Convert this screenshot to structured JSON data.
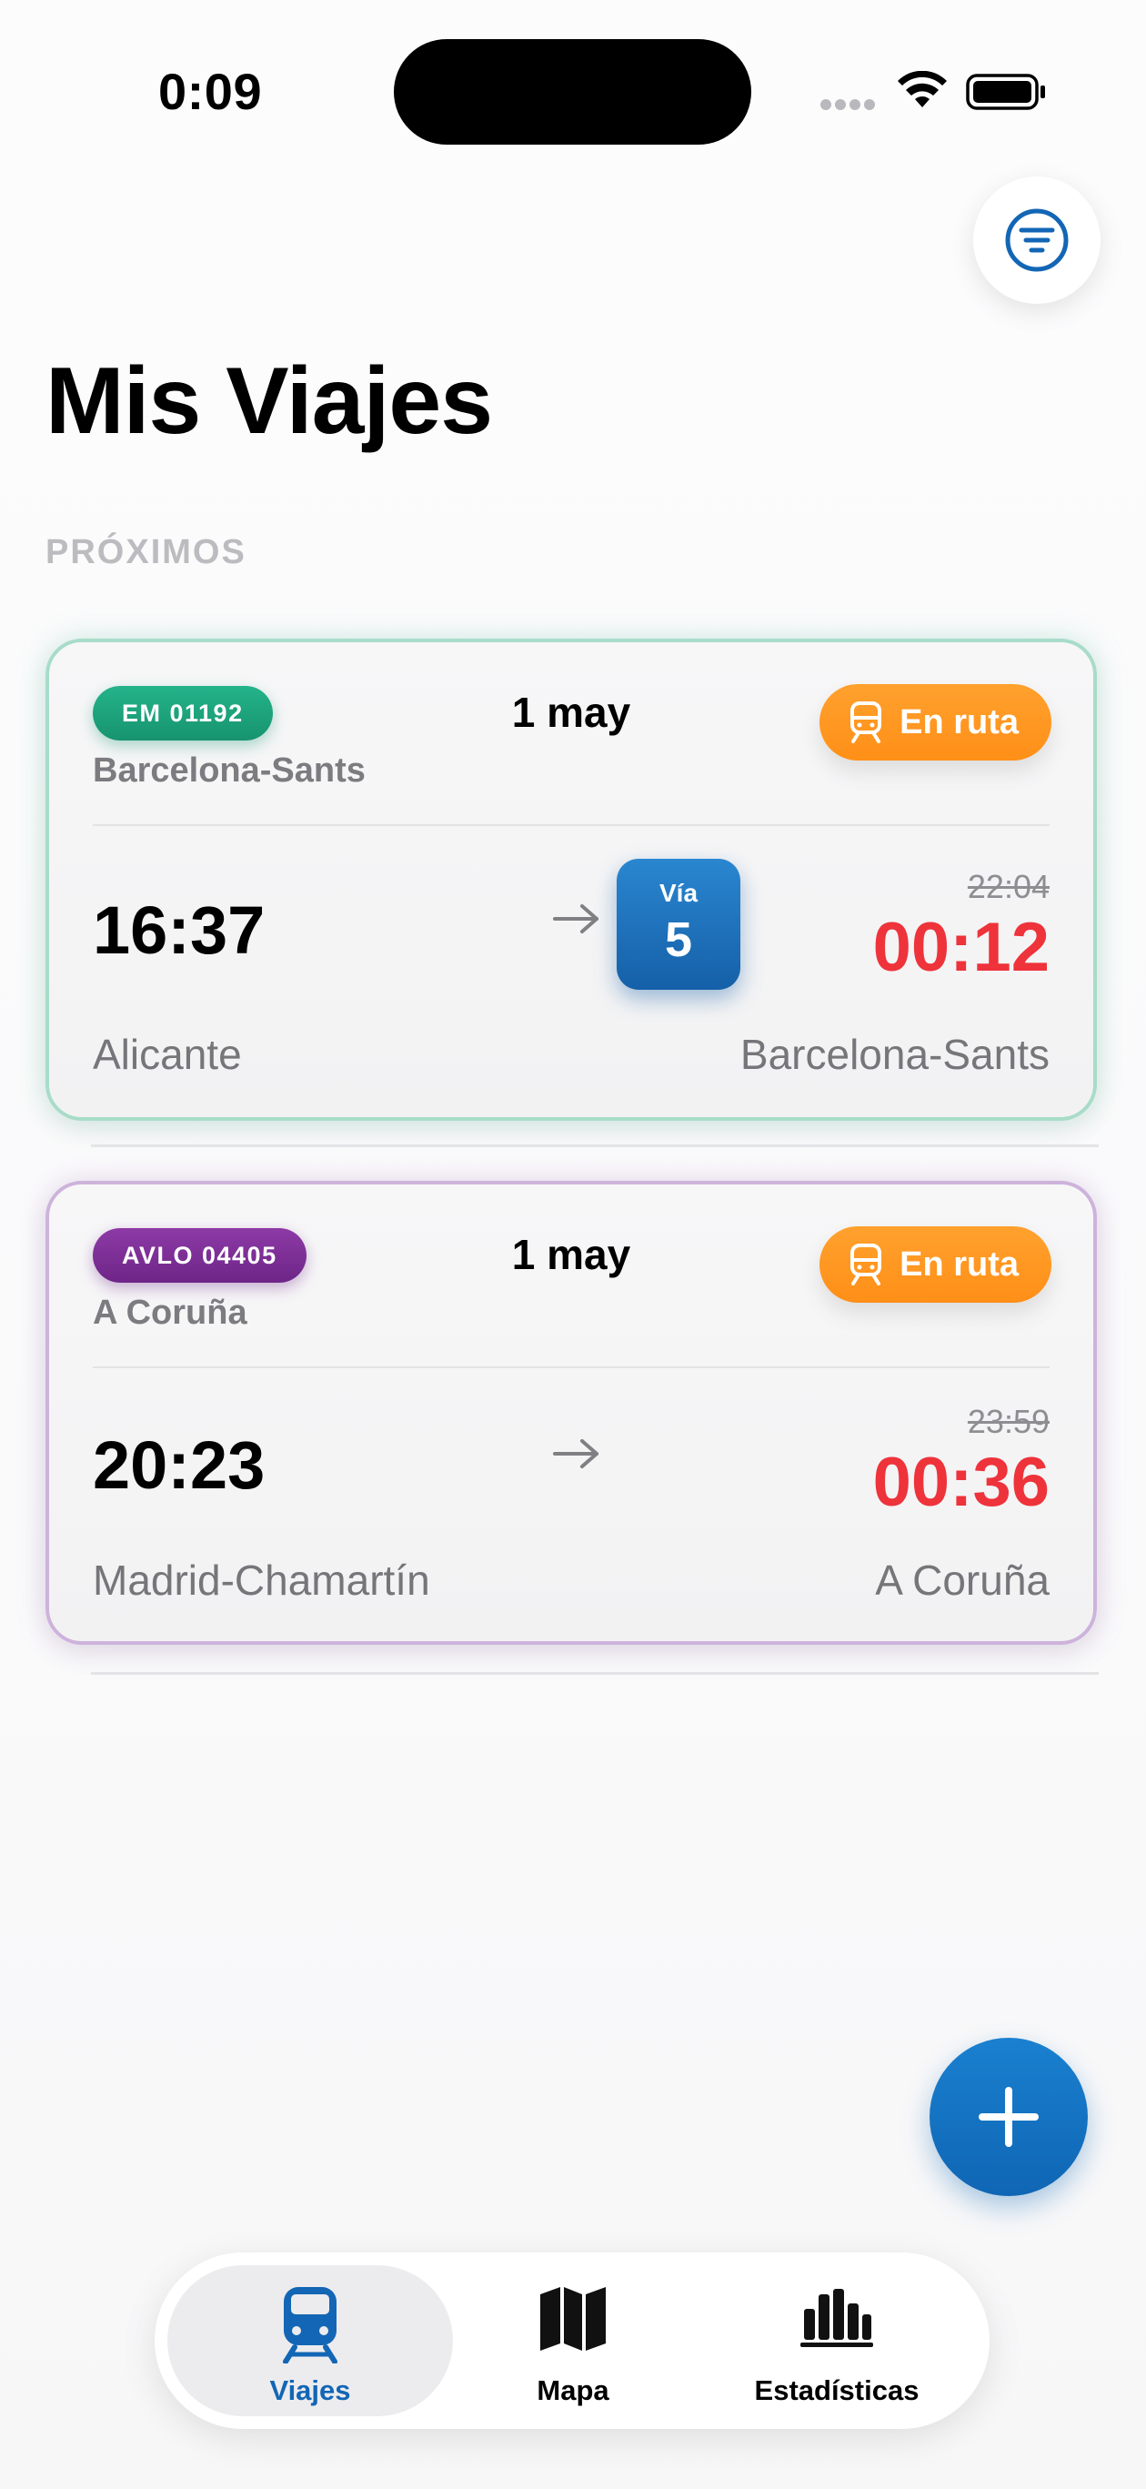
{
  "status_bar": {
    "time": "0:09"
  },
  "header": {
    "title": "Mis Viajes",
    "filter_icon": "filter-icon"
  },
  "section": {
    "label": "PRÓXIMOS"
  },
  "trips": [
    {
      "badge": "EM 01192",
      "badge_color": "#17946f",
      "subtitle": "Barcelona-Sants",
      "date": "1 may",
      "status": "En ruta",
      "status_icon": "train-icon",
      "departure_time": "16:37",
      "platform_label": "Vía",
      "platform_number": "5",
      "scheduled_arrival": "22:04",
      "actual_arrival": "00:12",
      "origin": "Alicante",
      "destination": "Barcelona-Sants"
    },
    {
      "badge": "AVLO 04405",
      "badge_color": "#6e2587",
      "subtitle": "A Coruña",
      "date": "1 may",
      "status": "En ruta",
      "status_icon": "train-icon",
      "departure_time": "20:23",
      "scheduled_arrival": "23:59",
      "actual_arrival": "00:36",
      "origin": "Madrid-Chamartín",
      "destination": "A Coruña"
    }
  ],
  "fab": {
    "icon": "plus-icon"
  },
  "tab_bar": {
    "tabs": [
      {
        "label": "Viajes",
        "icon": "train-icon",
        "active": true
      },
      {
        "label": "Mapa",
        "icon": "map-icon",
        "active": false
      },
      {
        "label": "Estadísticas",
        "icon": "bar-chart-icon",
        "active": false
      }
    ]
  },
  "colors": {
    "accent": "#0f66b4",
    "status_orange": "#ff8f17",
    "delay_red": "#ee333b"
  }
}
